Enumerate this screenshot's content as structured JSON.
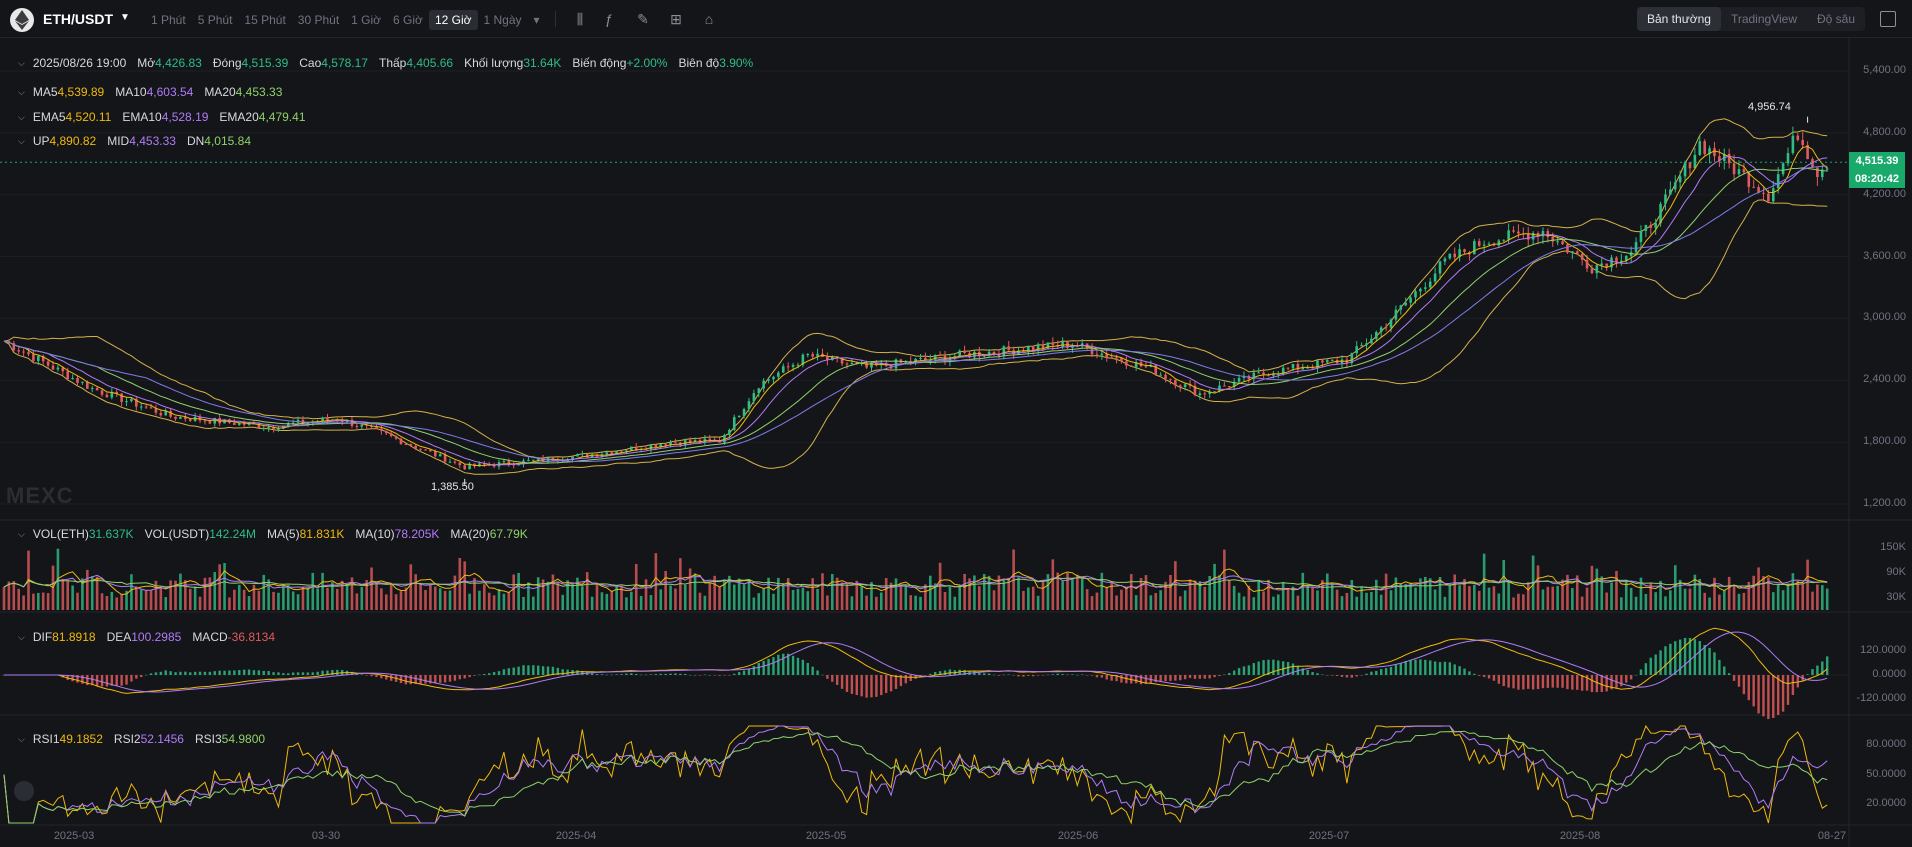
{
  "toolbar": {
    "pair": "ETH/USDT",
    "intervals": [
      "1 Phút",
      "5 Phút",
      "15 Phút",
      "30 Phút",
      "1 Giờ",
      "6 Giờ",
      "12 Giờ",
      "1 Ngày"
    ],
    "active_interval": "12 Giờ",
    "views": [
      "Bản thường",
      "TradingView",
      "Độ sâu"
    ],
    "active_view": "Bản thường",
    "icons": [
      "indicator-icon",
      "formula-icon",
      "pencil-icon",
      "layout-grid-icon",
      "camera-icon"
    ]
  },
  "ohlc": {
    "datetime": "2025/08/26 19:00",
    "open_label": "Mở",
    "open": "4,426.83",
    "close_label": "Đóng",
    "close": "4,515.39",
    "high_label": "Cao",
    "high": "4,578.17",
    "low_label": "Thấp",
    "low": "4,405.66",
    "volume_label": "Khối lượng",
    "volume": "31.64K",
    "change_label": "Biến động",
    "change": "+2.00%",
    "amplitude_label": "Biên độ",
    "amplitude": "3.90%"
  },
  "ma": {
    "ma5_label": "MA5",
    "ma5": "4,539.89",
    "ma10_label": "MA10",
    "ma10": "4,603.54",
    "ma20_label": "MA20",
    "ma20": "4,453.33"
  },
  "ema": {
    "ema5_label": "EMA5",
    "ema5": "4,520.11",
    "ema10_label": "EMA10",
    "ema10": "4,528.19",
    "ema20_label": "EMA20",
    "ema20": "4,479.41"
  },
  "boll": {
    "up_label": "UP",
    "up": "4,890.82",
    "mid_label": "MID",
    "mid": "4,453.33",
    "dn_label": "DN",
    "dn": "4,015.84"
  },
  "vol": {
    "eth_label": "VOL(ETH)",
    "eth": "31.637K",
    "usdt_label": "VOL(USDT)",
    "usdt": "142.24M",
    "ma5_label": "MA(5)",
    "ma5": "81.831K",
    "ma10_label": "MA(10)",
    "ma10": "78.205K",
    "ma20_label": "MA(20)",
    "ma20": "67.79K"
  },
  "macd": {
    "dif_label": "DIF",
    "dif": "81.8918",
    "dea_label": "DEA",
    "dea": "100.2985",
    "macd_label": "MACD",
    "macd": "-36.8134"
  },
  "rsi": {
    "rsi1_label": "RSI1",
    "rsi1": "49.1852",
    "rsi2_label": "RSI2",
    "rsi2": "52.1456",
    "rsi3_label": "RSI3",
    "rsi3": "54.9800"
  },
  "price_axis": [
    "5,400.00",
    "4,800.00",
    "4,200.00",
    "3,600.00",
    "3,000.00",
    "2,400.00",
    "1,800.00",
    "1,200.00"
  ],
  "vol_axis": [
    "150K",
    "90K",
    "30K"
  ],
  "macd_axis": [
    "120.0000",
    "0.0000",
    "-120.0000"
  ],
  "rsi_axis": [
    "80.0000",
    "50.0000",
    "20.0000"
  ],
  "x_axis": [
    "2025-03",
    "03-30",
    "2025-04",
    "2025-05",
    "2025-06",
    "2025-07",
    "2025-08",
    "08-27"
  ],
  "last_price": "4,515.39",
  "countdown": "08:20:42",
  "high_annotation": "4,956.74",
  "low_annotation": "1,385.50",
  "watermark": "MEXC",
  "colors": {
    "up": "#2ebd85",
    "down": "#e05b5b",
    "ma5": "#f0b90b",
    "ma10": "#b07cf7",
    "ma20": "#8fd16a",
    "boll": "#d4b14a",
    "bg": "#141519"
  },
  "chart_data": {
    "type": "candlestick",
    "x_start": "2025-02-21",
    "x_end": "2025-08-27",
    "y_scale": "price",
    "price_range": [
      1200,
      5400
    ],
    "anchor_closes": [
      [
        "2025-02-21",
        2780
      ],
      [
        "2025-03-02",
        2320
      ],
      [
        "2025-03-10",
        2050
      ],
      [
        "2025-03-20",
        1950
      ],
      [
        "2025-03-27",
        2030
      ],
      [
        "2025-04-01",
        1870
      ],
      [
        "2025-04-09",
        1560
      ],
      [
        "2025-04-15",
        1610
      ],
      [
        "2025-04-22",
        1680
      ],
      [
        "2025-04-30",
        1800
      ],
      [
        "2025-05-05",
        1810
      ],
      [
        "2025-05-09",
        2360
      ],
      [
        "2025-05-14",
        2640
      ],
      [
        "2025-05-20",
        2520
      ],
      [
        "2025-05-30",
        2650
      ],
      [
        "2025-06-10",
        2750
      ],
      [
        "2025-06-18",
        2510
      ],
      [
        "2025-06-23",
        2270
      ],
      [
        "2025-06-30",
        2480
      ],
      [
        "2025-07-08",
        2600
      ],
      [
        "2025-07-12",
        2950
      ],
      [
        "2025-07-18",
        3550
      ],
      [
        "2025-07-22",
        3750
      ],
      [
        "2025-07-28",
        3850
      ],
      [
        "2025-08-02",
        3500
      ],
      [
        "2025-08-06",
        3650
      ],
      [
        "2025-08-10",
        4200
      ],
      [
        "2025-08-13",
        4700
      ],
      [
        "2025-08-18",
        4350
      ],
      [
        "2025-08-20",
        4200
      ],
      [
        "2025-08-23",
        4800
      ],
      [
        "2025-08-25",
        4426
      ],
      [
        "2025-08-26",
        4515
      ]
    ],
    "high": 4956.74,
    "low": 1385.5,
    "vol_range": [
      0,
      190000
    ],
    "macd_range": [
      -170,
      250
    ],
    "rsi_range": [
      0,
      100
    ]
  }
}
